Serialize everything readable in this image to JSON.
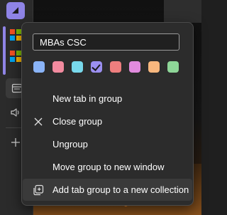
{
  "group": {
    "name_value": "MBAs CSC",
    "accent_color": "#8f84e6"
  },
  "colors": [
    {
      "name": "blue",
      "hex": "#8ab4f8",
      "selected": false
    },
    {
      "name": "pink",
      "hex": "#f28b9f",
      "selected": false
    },
    {
      "name": "cyan",
      "hex": "#78d9ec",
      "selected": false
    },
    {
      "name": "purple",
      "hex": "#9b8ff0",
      "selected": true
    },
    {
      "name": "red",
      "hex": "#ee7e7e",
      "selected": false
    },
    {
      "name": "magenta",
      "hex": "#e18bde",
      "selected": false
    },
    {
      "name": "orange",
      "hex": "#f8b77e",
      "selected": false
    },
    {
      "name": "green",
      "hex": "#8ed698",
      "selected": false
    }
  ],
  "menu": {
    "new_tab": "New tab in group",
    "close_group": "Close group",
    "ungroup": "Ungroup",
    "move_group": "Move group to new window",
    "add_to_collection": "Add tab group to a new collection"
  },
  "icons": {
    "close": "close-icon",
    "collection": "collection-add-icon",
    "group_toggle": "chevron-icon",
    "tab": "microsoft-logo-icon",
    "speaker": "speaker-icon",
    "add": "plus-icon"
  }
}
